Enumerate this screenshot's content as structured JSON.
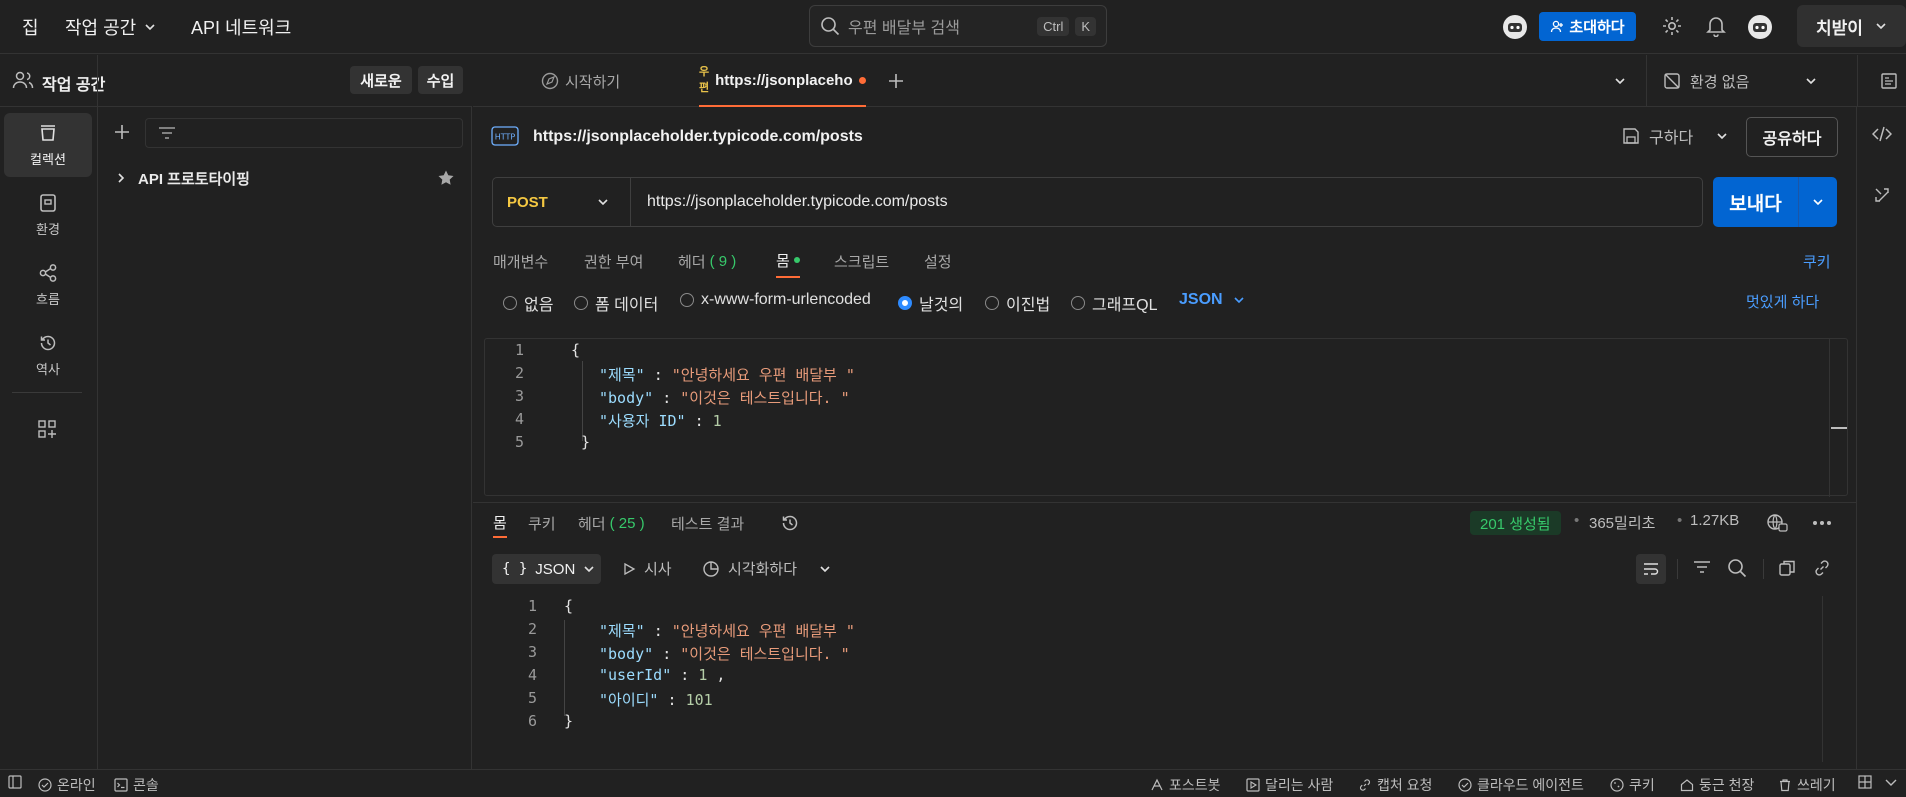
{
  "topbar": {
    "home": "집",
    "workspace": "작업 공간",
    "api_network": "API 네트워크",
    "search_placeholder": "우편 배달부 검색",
    "shortcut_ctrl": "Ctrl",
    "shortcut_k": "K",
    "invite": "초대하다",
    "upgrade": "치받이"
  },
  "rail": {
    "items": [
      {
        "label": "컬렉션",
        "icon": "collection-icon"
      },
      {
        "label": "환경",
        "icon": "environment-icon"
      },
      {
        "label": "흐름",
        "icon": "flows-icon"
      },
      {
        "label": "역사",
        "icon": "history-icon"
      }
    ]
  },
  "workspace_panel": {
    "title": "작업 공간",
    "new": "새로운",
    "import": "수입",
    "collection_name": "API 프로토타이핑"
  },
  "tabs": {
    "start": "시작하기",
    "active_prefix_top": "우",
    "active_prefix_bottom": "편",
    "active_label": "https://jsonplaceholder.ty",
    "env": "환경 없음"
  },
  "request": {
    "name": "https://jsonplaceholder.typicode.com/posts",
    "save": "구하다",
    "share": "공유하다",
    "method": "POST",
    "url": "https://jsonplaceholder.typicode.com/posts",
    "send": "보내다",
    "tabs": [
      "매개변수",
      "권한 부여",
      "헤더",
      "몸",
      "스크립트",
      "설정"
    ],
    "headers_count": "( 9 )",
    "cookies": "쿠키",
    "body_types": [
      "없음",
      "폼 데이터",
      "x-www-form-urlencoded",
      "날것의",
      "이진법",
      "그래프QL"
    ],
    "raw_format": "JSON",
    "beautify": "멋있게 하다",
    "body_lines": [
      {
        "n": "1",
        "text": "{"
      },
      {
        "n": "2",
        "key": "\"제목\"",
        "value": "\"안녕하세요 우편 배달부 \""
      },
      {
        "n": "3",
        "key": "\"body\"",
        "value": "\"이것은 테스트입니다. \""
      },
      {
        "n": "4",
        "key": "\"사용자 ID\"",
        "value": "1"
      },
      {
        "n": "5",
        "text": "}"
      }
    ]
  },
  "response": {
    "tabs": [
      "몸",
      "쿠키",
      "헤더",
      "테스트 결과"
    ],
    "headers_count": "( 25 )",
    "status": "201 생성됨",
    "time": "365밀리초",
    "size": "1.27KB",
    "format": "JSON",
    "preview": "시사",
    "visualize": "시각화하다",
    "lines": [
      {
        "n": "1",
        "text": "{"
      },
      {
        "n": "2",
        "key": "\"제목\"",
        "value": "\"안녕하세요 우편 배달부 \"",
        "comma": ""
      },
      {
        "n": "3",
        "key": "\"body\"",
        "value": "\"이것은 테스트입니다. \"",
        "comma": ""
      },
      {
        "n": "4",
        "key": "\"userId\"",
        "value": "1",
        "comma": " ,"
      },
      {
        "n": "5",
        "key": "\"아이디\"",
        "value": "101",
        "comma": ""
      },
      {
        "n": "6",
        "text": "}"
      }
    ]
  },
  "statusbar": {
    "online": "온라인",
    "console": "콘솔",
    "postbot": "포스트봇",
    "runner": "달리는 사람",
    "capture": "캡처 요청",
    "cloud_agent": "클라우드 에이전트",
    "cookies": "쿠키",
    "vault": "둥근 천장",
    "trash": "쓰레기"
  },
  "colors": {
    "accent": "#0265d2",
    "status_ok": "#37c96b",
    "dirty_dot": "#ff6c37"
  }
}
